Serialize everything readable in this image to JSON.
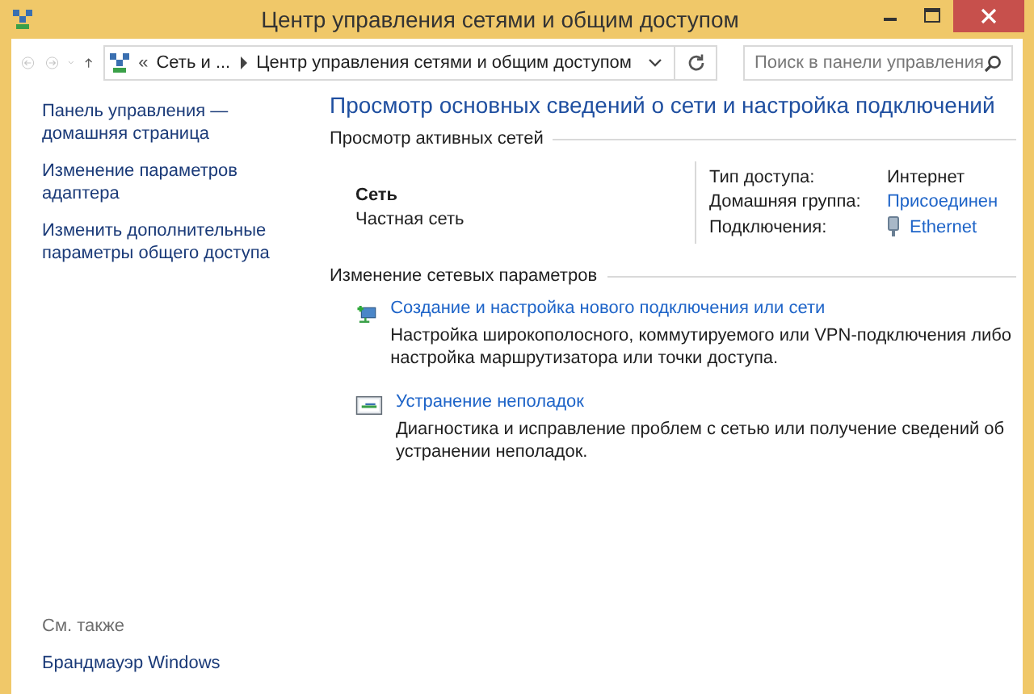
{
  "window": {
    "title": "Центр управления сетями и общим доступом"
  },
  "address_bar": {
    "crumbs": [
      "Сеть и ...",
      "Центр управления сетями и общим доступом"
    ],
    "overflow": "«"
  },
  "search": {
    "placeholder": "Поиск в панели управления"
  },
  "sidebar": {
    "items": [
      {
        "label": "Панель управления — домашняя страница"
      },
      {
        "label": "Изменение параметров адаптера"
      },
      {
        "label": "Изменить дополнительные параметры общего доступа"
      }
    ],
    "see_also": {
      "heading": "См. также",
      "items": [
        {
          "label": "Брандмауэр Windows"
        }
      ]
    }
  },
  "main": {
    "heading": "Просмотр основных сведений о сети и настройка подключений",
    "active_networks": {
      "heading": "Просмотр активных сетей",
      "network_name": "Сеть",
      "network_type": "Частная сеть",
      "properties": [
        {
          "label": "Тип доступа:",
          "value": "Интернет",
          "kind": "text"
        },
        {
          "label": "Домашняя группа:",
          "value": "Присоединен",
          "kind": "link"
        },
        {
          "label": "Подключения:",
          "value": "Ethernet",
          "kind": "connection"
        }
      ]
    },
    "change_settings": {
      "heading": "Изменение сетевых параметров",
      "tasks": [
        {
          "title": "Создание и настройка нового подключения или сети",
          "description": "Настройка широкополосного, коммутируемого или VPN-подключения либо настройка маршрутизатора или точки доступа.",
          "kind": "new-connection"
        },
        {
          "title": "Устранение неполадок",
          "description": "Диагностика и исправление проблем с сетью или получение сведений об устранении неполадок.",
          "kind": "troubleshoot"
        }
      ]
    }
  }
}
